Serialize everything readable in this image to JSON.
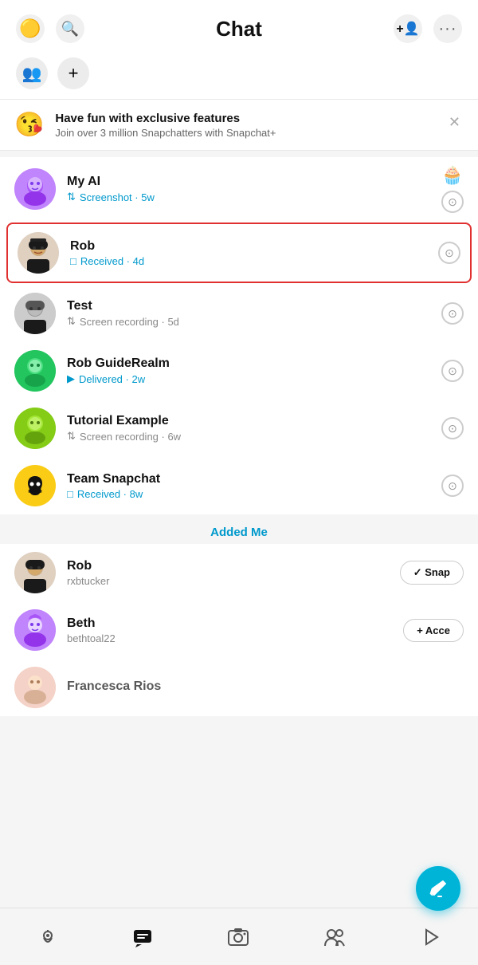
{
  "header": {
    "title": "Chat",
    "add_friend_icon": "👤+",
    "more_icon": "···"
  },
  "subheader": {
    "groups_icon": "👥",
    "add_icon": "+"
  },
  "promo": {
    "emoji": "😘",
    "title": "Have fun with exclusive features",
    "subtitle": "Join over 3 million Snapchatters with Snapchat+"
  },
  "chats": [
    {
      "id": "myai",
      "name": "My AI",
      "sub": "Screenshot · 5w",
      "sub_color": "blue",
      "status_icon": "↕",
      "extra": "🧁",
      "avatar_emoji": "🤖",
      "avatar_class": "avatar-myai",
      "highlighted": false
    },
    {
      "id": "rob",
      "name": "Rob",
      "sub": "Received · 4d",
      "sub_color": "blue",
      "status_icon": "□",
      "avatar_emoji": "🧔",
      "avatar_class": "avatar-rob",
      "highlighted": true
    },
    {
      "id": "test",
      "name": "Test",
      "sub": "Screen recording · 5d",
      "sub_color": "gray",
      "status_icon": "↕",
      "avatar_emoji": "🧔",
      "avatar_class": "avatar-test",
      "highlighted": false
    },
    {
      "id": "robguide",
      "name": "Rob GuideRealm",
      "sub": "Delivered · 2w",
      "sub_color": "blue",
      "status_icon": "▶",
      "avatar_emoji": "👤",
      "avatar_class": "avatar-robguide",
      "highlighted": false
    },
    {
      "id": "tutorial",
      "name": "Tutorial Example",
      "sub": "Screen recording · 6w",
      "sub_color": "gray",
      "status_icon": "↕",
      "avatar_emoji": "👤",
      "avatar_class": "avatar-tutorial",
      "highlighted": false
    },
    {
      "id": "team",
      "name": "Team Snapchat",
      "sub": "Received · 8w",
      "sub_color": "blue",
      "status_icon": "□",
      "avatar_emoji": "👻",
      "avatar_class": "avatar-team",
      "highlighted": false,
      "is_ghost": true
    }
  ],
  "section_label": "Added Me",
  "added_me": [
    {
      "id": "rob-added",
      "name": "Rob",
      "handle": "rxbtucker",
      "action": "✓ Snap",
      "action_class": "snap-btn"
    },
    {
      "id": "beth-added",
      "name": "Beth",
      "handle": "bethtoal22",
      "action": "+ Acce",
      "action_class": "accept-btn"
    },
    {
      "id": "francesca-added",
      "name": "Francesca Rios",
      "handle": "",
      "action": "",
      "action_class": ""
    }
  ],
  "nav": {
    "items": [
      {
        "id": "map",
        "icon": "◎",
        "active": false
      },
      {
        "id": "chat",
        "icon": "💬",
        "active": true
      },
      {
        "id": "camera",
        "icon": "⊙",
        "active": false
      },
      {
        "id": "friends",
        "icon": "👥",
        "active": false
      },
      {
        "id": "stories",
        "icon": "▷",
        "active": false
      }
    ]
  }
}
